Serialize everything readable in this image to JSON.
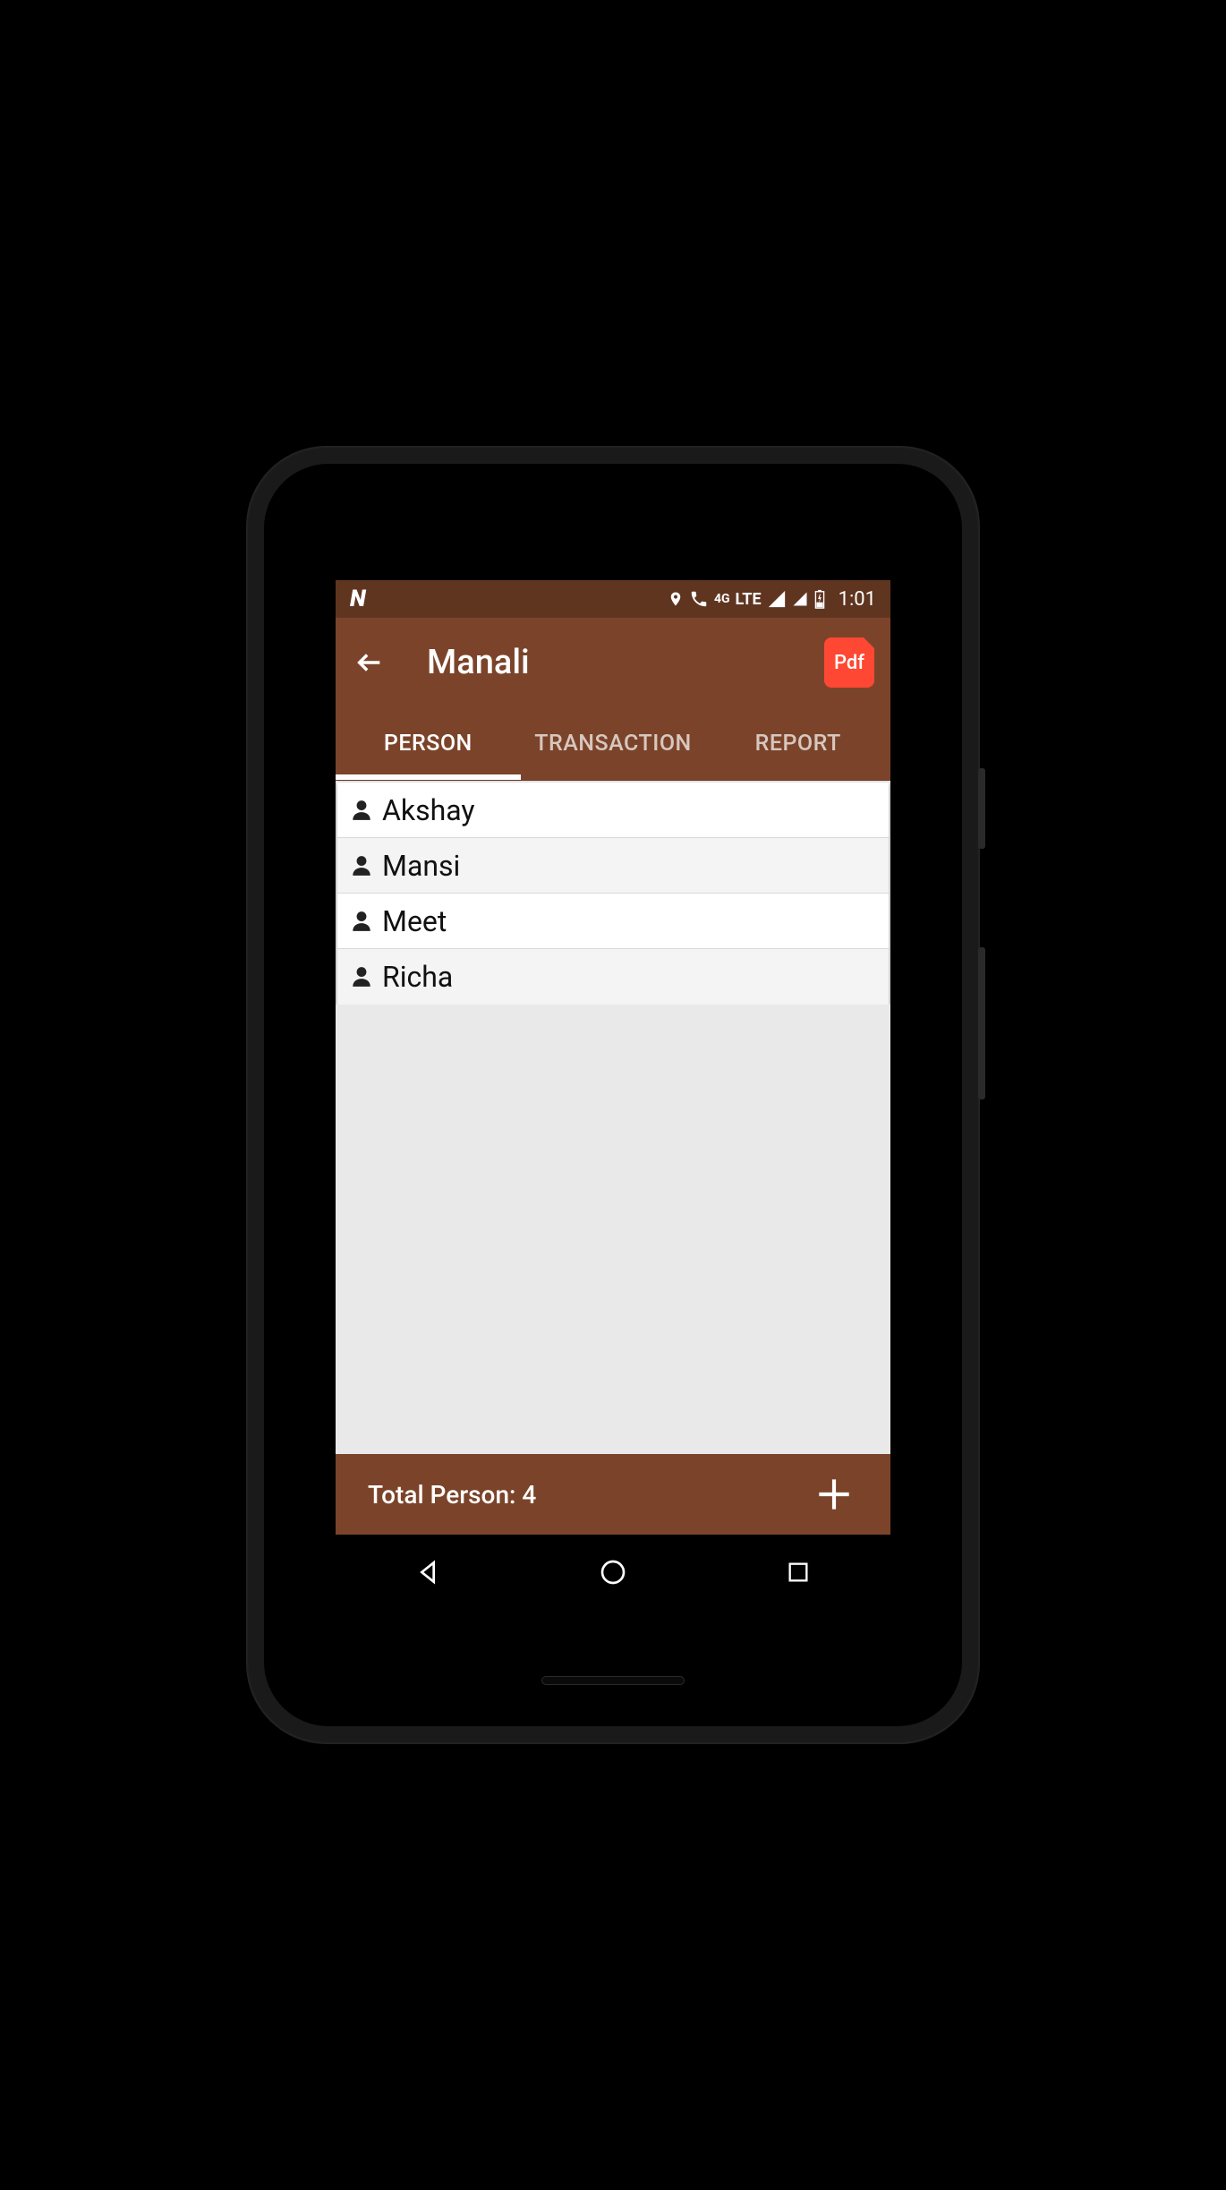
{
  "status": {
    "n_icon": "N",
    "network": "LTE",
    "gen": "4G",
    "time": "1:01"
  },
  "header": {
    "title": "Manali",
    "pdf_label": "Pdf"
  },
  "tabs": [
    {
      "label": "PERSON",
      "active": true
    },
    {
      "label": "TRANSACTION",
      "active": false
    },
    {
      "label": "REPORT",
      "active": false
    }
  ],
  "persons": [
    {
      "name": "Akshay"
    },
    {
      "name": "Mansi"
    },
    {
      "name": "Meet"
    },
    {
      "name": "Richa"
    }
  ],
  "footer": {
    "total_label": "Total Person: 4"
  }
}
